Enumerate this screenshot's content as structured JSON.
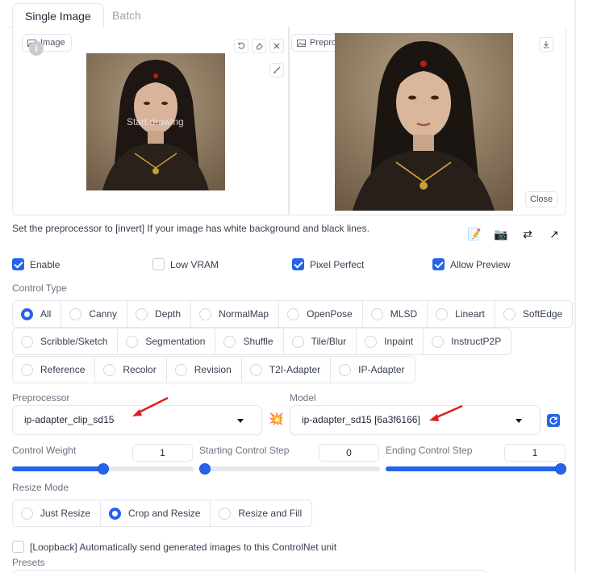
{
  "tabs": {
    "single": "Single Image",
    "batch": "Batch"
  },
  "image_panel": {
    "chip_label": "Image",
    "info_icon": "i",
    "overlay_text": "Start drawing",
    "buttons": [
      "undo-icon",
      "eraser-icon",
      "close-icon",
      "brush-icon"
    ]
  },
  "preview_panel": {
    "chip_label": "Preprocessor Preview",
    "close_label": "Close",
    "download_icon": "download-icon"
  },
  "hint": "Set the preprocessor to [invert] If your image has white background and black lines.",
  "tools": {
    "edit": "📝",
    "camera": "📷",
    "swap": "⇄",
    "send": "↗"
  },
  "options": {
    "enable": "Enable",
    "low_vram": "Low VRAM",
    "pixel_perfect": "Pixel Perfect",
    "allow_preview": "Allow Preview"
  },
  "control_type": {
    "label": "Control Type",
    "row1": [
      "All",
      "Canny",
      "Depth",
      "NormalMap",
      "OpenPose",
      "MLSD",
      "Lineart",
      "SoftEdge"
    ],
    "row2": [
      "Scribble/Sketch",
      "Segmentation",
      "Shuffle",
      "Tile/Blur",
      "Inpaint",
      "InstructP2P"
    ],
    "row3": [
      "Reference",
      "Recolor",
      "Revision",
      "T2I-Adapter",
      "IP-Adapter"
    ],
    "selected": "All"
  },
  "preprocessor": {
    "label": "Preprocessor",
    "value": "ip-adapter_clip_sd15",
    "run_icon": "💥"
  },
  "model": {
    "label": "Model",
    "value": "ip-adapter_sd15 [6a3f6166]",
    "refresh_icon": "refresh-icon"
  },
  "sliders": {
    "weight": {
      "label": "Control Weight",
      "value": "1",
      "fraction": 0.5
    },
    "start": {
      "label": "Starting Control Step",
      "value": "0",
      "fraction": 0.0
    },
    "end": {
      "label": "Ending Control Step",
      "value": "1",
      "fraction": 1.0
    }
  },
  "resize": {
    "label": "Resize Mode",
    "options": [
      "Just Resize",
      "Crop and Resize",
      "Resize and Fill"
    ],
    "selected": "Crop and Resize"
  },
  "loopback": "[Loopback] Automatically send generated images to this ControlNet unit",
  "presets_label": "Presets",
  "colors": {
    "accent": "#2563eb",
    "arrow": "#e11d1d"
  }
}
